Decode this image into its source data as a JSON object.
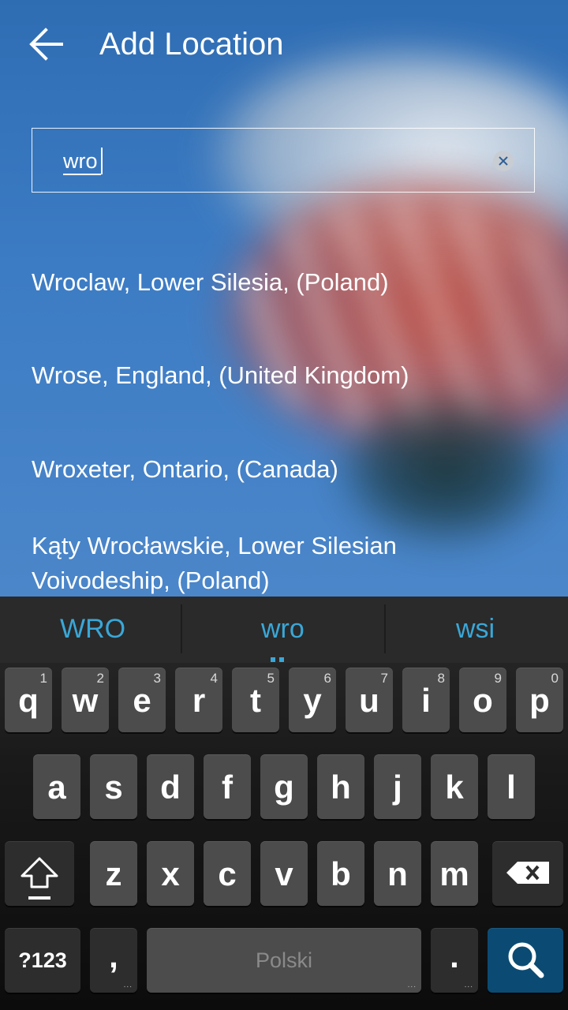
{
  "header": {
    "title": "Add Location",
    "back_icon": "arrow-left-icon"
  },
  "search": {
    "value": "wro",
    "clear_icon": "clear-icon"
  },
  "results": [
    {
      "text": "Wroclaw, Lower Silesia, (Poland)"
    },
    {
      "text": "Wrose, England, (United Kingdom)"
    },
    {
      "text": "Wroxeter, Ontario, (Canada)"
    },
    {
      "text": "Kąty Wrocławskie, Lower Silesian Voivodeship, (Poland)"
    }
  ],
  "keyboard": {
    "suggestions": [
      "WRO",
      "wro",
      "wsi"
    ],
    "row1": [
      {
        "key": "q",
        "hint": "1"
      },
      {
        "key": "w",
        "hint": "2"
      },
      {
        "key": "e",
        "hint": "3"
      },
      {
        "key": "r",
        "hint": "4"
      },
      {
        "key": "t",
        "hint": "5"
      },
      {
        "key": "y",
        "hint": "6"
      },
      {
        "key": "u",
        "hint": "7"
      },
      {
        "key": "i",
        "hint": "8"
      },
      {
        "key": "o",
        "hint": "9"
      },
      {
        "key": "p",
        "hint": "0"
      }
    ],
    "row2": [
      "a",
      "s",
      "d",
      "f",
      "g",
      "h",
      "j",
      "k",
      "l"
    ],
    "row3": [
      "z",
      "x",
      "c",
      "v",
      "b",
      "n",
      "m"
    ],
    "symbols_label": "?123",
    "comma_label": ",",
    "space_label": "Polski",
    "period_label": ".",
    "shift_icon": "shift-icon",
    "backspace_icon": "backspace-icon",
    "search_icon": "search-icon",
    "colors": {
      "suggestion": "#3aa7d7",
      "search_key": "#0b4b73"
    }
  }
}
